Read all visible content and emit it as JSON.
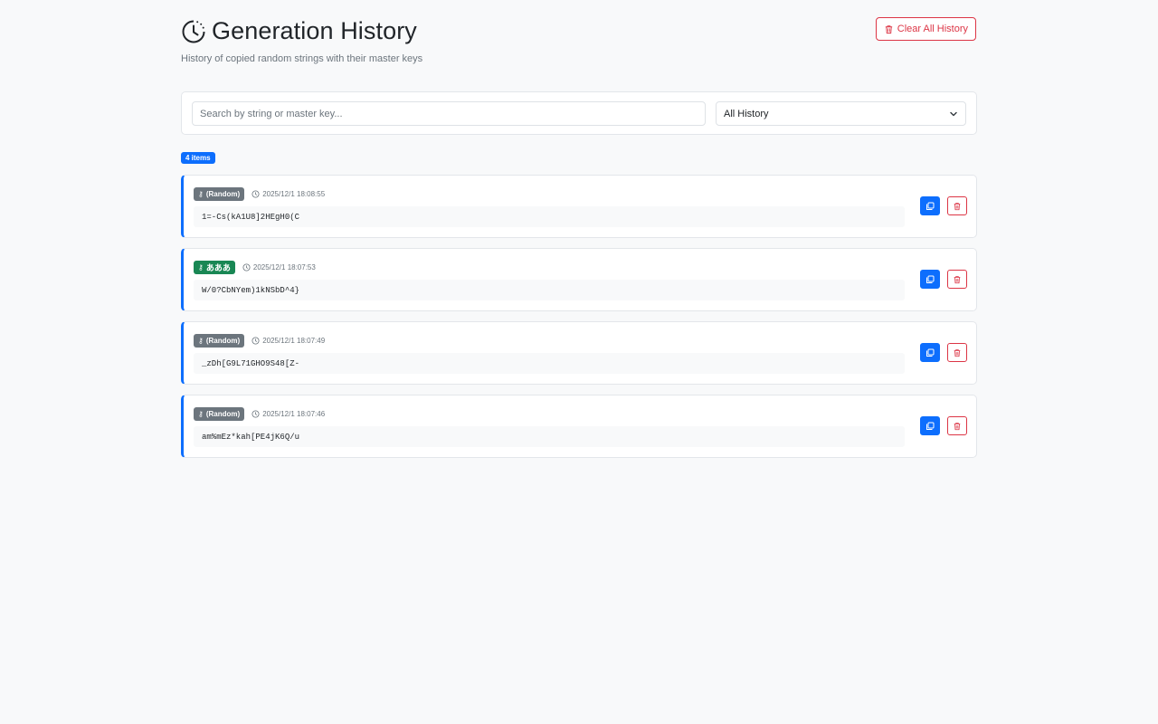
{
  "header": {
    "title": "Generation History",
    "subtitle": "History of copied random strings with their master keys",
    "clear_label": "Clear All History"
  },
  "filters": {
    "search_placeholder": "Search by string or master key...",
    "select_value": "All History"
  },
  "count_label": "4 items",
  "colors": {
    "accent": "#0d6efd",
    "danger": "#dc3545",
    "random_badge": "#6c757d",
    "named_badge": "#198754"
  },
  "items": [
    {
      "key_label": "(Random)",
      "key_type": "random",
      "timestamp": "2025/12/1 18:08:55",
      "value": "1=-Cs(kA1U8]2HEgH0(C"
    },
    {
      "key_label": "あああ",
      "key_type": "named",
      "timestamp": "2025/12/1 18:07:53",
      "value": "W/0?CbNYem)1kNSbD^4}"
    },
    {
      "key_label": "(Random)",
      "key_type": "random",
      "timestamp": "2025/12/1 18:07:49",
      "value": "_zDh[G9L71GHO9S48[Z-"
    },
    {
      "key_label": "(Random)",
      "key_type": "random",
      "timestamp": "2025/12/1 18:07:46",
      "value": "am%mEz*kah[PE4jK6Q/u"
    }
  ]
}
